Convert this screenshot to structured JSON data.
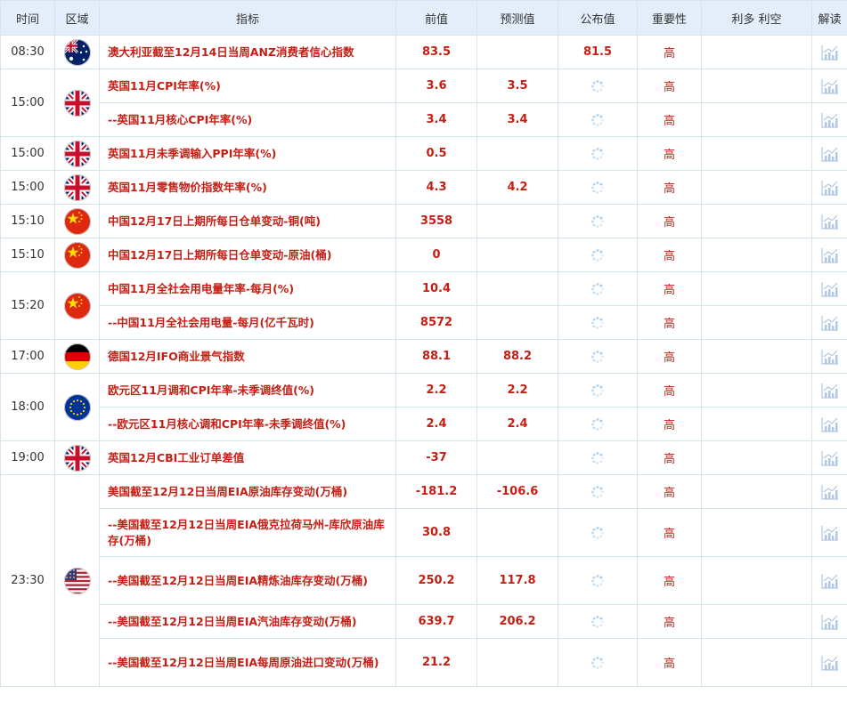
{
  "headers": [
    "时间",
    "区域",
    "指标",
    "前值",
    "预测值",
    "公布值",
    "重要性",
    "利多 利空",
    "解读"
  ],
  "colors": {
    "accent": "#c51e14",
    "header_bg": "#e4eefb",
    "border": "#d6e3f3",
    "loader": "#9cc4ea",
    "chart_icon": "#b0c8e4"
  },
  "rows": [
    {
      "time": "08:30",
      "flag": "au",
      "indicator": "澳大利亚截至12月14日当周ANZ消费者信心指数",
      "prev": "83.5",
      "forecast": "",
      "actual": "81.5",
      "importance": "高"
    },
    {
      "time": "15:00",
      "flag": "gb",
      "indicator": "英国11月CPI年率(%)",
      "prev": "3.6",
      "forecast": "3.5",
      "actual": "",
      "importance": "高"
    },
    {
      "time": "",
      "flag": "",
      "indicator": "--英国11月核心CPI年率(%)",
      "prev": "3.4",
      "forecast": "3.4",
      "actual": "",
      "importance": "高"
    },
    {
      "time": "15:00",
      "flag": "gb",
      "indicator": "英国11月未季调输入PPI年率(%)",
      "prev": "0.5",
      "forecast": "",
      "actual": "",
      "importance": "高"
    },
    {
      "time": "15:00",
      "flag": "gb",
      "indicator": "英国11月零售物价指数年率(%)",
      "prev": "4.3",
      "forecast": "4.2",
      "actual": "",
      "importance": "高"
    },
    {
      "time": "15:10",
      "flag": "cn",
      "indicator": "中国12月17日上期所每日仓单变动-铜(吨)",
      "prev": "3558",
      "forecast": "",
      "actual": "",
      "importance": "高"
    },
    {
      "time": "15:10",
      "flag": "cn",
      "indicator": "中国12月17日上期所每日仓单变动-原油(桶)",
      "prev": "0",
      "forecast": "",
      "actual": "",
      "importance": "高"
    },
    {
      "time": "15:20",
      "flag": "cn",
      "indicator": "中国11月全社会用电量年率-每月(%)",
      "prev": "10.4",
      "forecast": "",
      "actual": "",
      "importance": "高"
    },
    {
      "time": "",
      "flag": "",
      "indicator": "--中国11月全社会用电量-每月(亿千瓦时)",
      "prev": "8572",
      "forecast": "",
      "actual": "",
      "importance": "高"
    },
    {
      "time": "17:00",
      "flag": "de",
      "indicator": "德国12月IFO商业景气指数",
      "prev": "88.1",
      "forecast": "88.2",
      "actual": "",
      "importance": "高"
    },
    {
      "time": "18:00",
      "flag": "eu",
      "indicator": "欧元区11月调和CPI年率-未季调终值(%)",
      "prev": "2.2",
      "forecast": "2.2",
      "actual": "",
      "importance": "高"
    },
    {
      "time": "",
      "flag": "",
      "indicator": "--欧元区11月核心调和CPI年率-未季调终值(%)",
      "prev": "2.4",
      "forecast": "2.4",
      "actual": "",
      "importance": "高"
    },
    {
      "time": "19:00",
      "flag": "gb",
      "indicator": "英国12月CBI工业订单差值",
      "prev": "-37",
      "forecast": "",
      "actual": "",
      "importance": "高"
    },
    {
      "time": "23:30",
      "flag": "us",
      "indicator": "美国截至12月12日当周EIA原油库存变动(万桶)",
      "prev": "-181.2",
      "forecast": "-106.6",
      "actual": "",
      "importance": "高"
    },
    {
      "time": "",
      "flag": "",
      "indicator": "--美国截至12月12日当周EIA俄克拉荷马州-库欣原油库存(万桶)",
      "prev": "30.8",
      "forecast": "",
      "actual": "",
      "importance": "高"
    },
    {
      "time": "",
      "flag": "",
      "indicator": "--美国截至12月12日当周EIA精炼油库存变动(万桶)",
      "prev": "250.2",
      "forecast": "117.8",
      "actual": "",
      "importance": "高"
    },
    {
      "time": "",
      "flag": "",
      "indicator": "--美国截至12月12日当周EIA汽油库存变动(万桶)",
      "prev": "639.7",
      "forecast": "206.2",
      "actual": "",
      "importance": "高"
    },
    {
      "time": "",
      "flag": "",
      "indicator": "--美国截至12月12日当周EIA每周原油进口变动(万桶)",
      "prev": "21.2",
      "forecast": "",
      "actual": "",
      "importance": "高"
    }
  ]
}
